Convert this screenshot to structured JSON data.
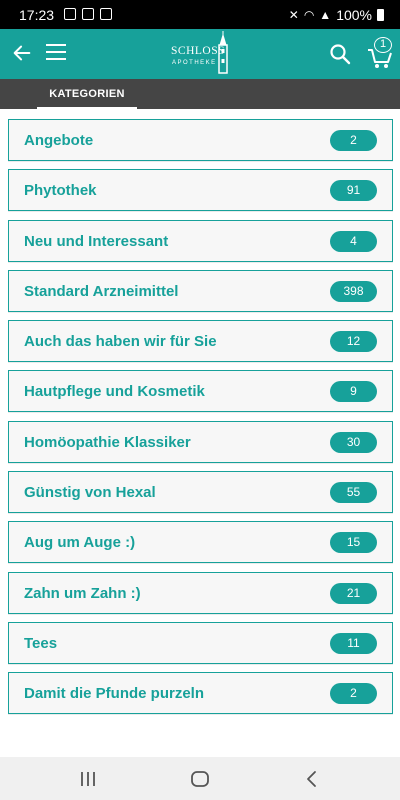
{
  "status": {
    "time": "17:23",
    "battery": "100%"
  },
  "header": {
    "logo_line1": "SCHLOSS",
    "logo_line2": "APOTHEKE",
    "cart_count": "1",
    "accent": "#17a19a"
  },
  "tabs": [
    {
      "label": "KATEGORIEN",
      "active": true
    }
  ],
  "categories": [
    {
      "label": "Angebote",
      "count": "2"
    },
    {
      "label": "Phytothek",
      "count": "91"
    },
    {
      "label": "Neu und Interessant",
      "count": "4"
    },
    {
      "label": "Standard Arzneimittel",
      "count": "398"
    },
    {
      "label": "Auch das haben wir für Sie",
      "count": "12"
    },
    {
      "label": "Hautpflege und Kosmetik",
      "count": "9"
    },
    {
      "label": "Homöopathie Klassiker",
      "count": "30"
    },
    {
      "label": "Günstig von Hexal",
      "count": "55"
    },
    {
      "label": "Aug um Auge :)",
      "count": "15"
    },
    {
      "label": "Zahn um Zahn :)",
      "count": "21"
    },
    {
      "label": "Tees",
      "count": "11"
    },
    {
      "label": "Damit die Pfunde purzeln",
      "count": "2"
    }
  ],
  "icons": {
    "back": "arrow-left-icon",
    "menu": "hamburger-menu-icon",
    "search": "search-icon",
    "cart": "shopping-cart-icon",
    "nav_recents": "recents-icon",
    "nav_home": "home-icon",
    "nav_back": "back-icon"
  }
}
